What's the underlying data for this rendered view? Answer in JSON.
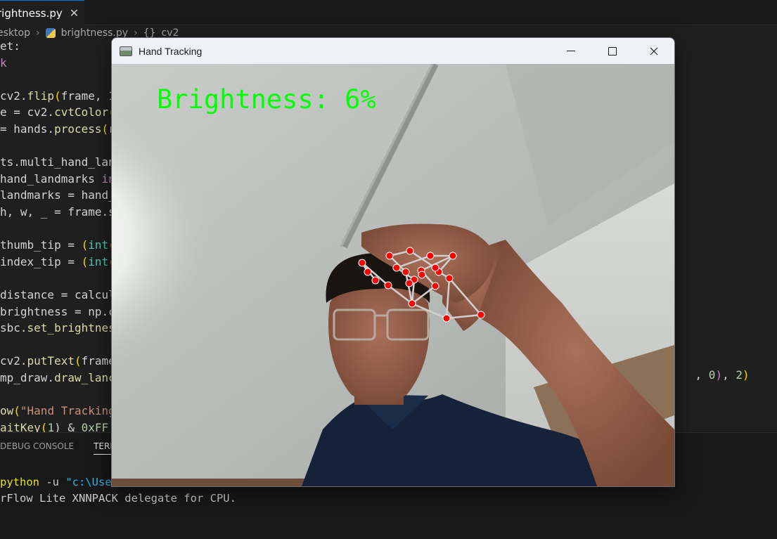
{
  "editor": {
    "tab_label": "rightness.py",
    "tab_close": "✕",
    "breadcrumb": {
      "folder": "esktop",
      "file": "brightness.py",
      "symbol_icon": "{}",
      "symbol": "cv2"
    },
    "code_lines": [
      [
        {
          "t": "et:",
          "c": ""
        }
      ],
      [
        {
          "t": "k",
          "c": "kw"
        }
      ],
      [
        {
          "t": "",
          "c": ""
        }
      ],
      [
        {
          "t": "cv2.",
          "c": ""
        },
        {
          "t": "flip",
          "c": "fn"
        },
        {
          "t": "(",
          "c": "par"
        },
        {
          "t": "frame, 1",
          "c": ""
        }
      ],
      [
        {
          "t": "e = cv2.",
          "c": ""
        },
        {
          "t": "cvtColor",
          "c": "fn"
        },
        {
          "t": "(",
          "c": "par"
        }
      ],
      [
        {
          "t": "= hands.",
          "c": ""
        },
        {
          "t": "process",
          "c": "fn"
        },
        {
          "t": "(",
          "c": "par"
        },
        {
          "t": "r",
          "c": ""
        }
      ],
      [
        {
          "t": "",
          "c": ""
        }
      ],
      [
        {
          "t": "ts.multi_hand_lan",
          "c": ""
        }
      ],
      [
        {
          "t": "hand_landmarks ",
          "c": ""
        },
        {
          "t": "in",
          "c": "kw"
        }
      ],
      [
        {
          "t": "landmarks = hand_",
          "c": ""
        }
      ],
      [
        {
          "t": "h, w, _ = frame.s",
          "c": ""
        }
      ],
      [
        {
          "t": "",
          "c": ""
        }
      ],
      [
        {
          "t": "thumb_tip = ",
          "c": ""
        },
        {
          "t": "(",
          "c": "par"
        },
        {
          "t": "int",
          "c": "typ"
        },
        {
          "t": "(",
          "c": "par"
        }
      ],
      [
        {
          "t": "index_tip = ",
          "c": ""
        },
        {
          "t": "(",
          "c": "par"
        },
        {
          "t": "int",
          "c": "typ"
        },
        {
          "t": "(",
          "c": "par"
        }
      ],
      [
        {
          "t": "",
          "c": ""
        }
      ],
      [
        {
          "t": "distance = calcul",
          "c": ""
        }
      ],
      [
        {
          "t": "brightness = np.c",
          "c": ""
        }
      ],
      [
        {
          "t": "sbc.",
          "c": ""
        },
        {
          "t": "set_brightnes",
          "c": "fn"
        }
      ],
      [
        {
          "t": "",
          "c": ""
        }
      ],
      [
        {
          "t": "cv2.",
          "c": ""
        },
        {
          "t": "putText",
          "c": "fn"
        },
        {
          "t": "(",
          "c": "par"
        },
        {
          "t": "frame",
          "c": ""
        }
      ],
      [
        {
          "t": "mp_draw.",
          "c": ""
        },
        {
          "t": "draw_lanc",
          "c": "fn"
        }
      ],
      [
        {
          "t": "",
          "c": ""
        }
      ],
      [
        {
          "t": "ow",
          "c": "fn"
        },
        {
          "t": "(",
          "c": "par"
        },
        {
          "t": "\"Hand Tracking",
          "c": "str"
        }
      ],
      [
        {
          "t": "aitKey",
          "c": "fn"
        },
        {
          "t": "(",
          "c": "par"
        },
        {
          "t": "1",
          "c": "num"
        },
        {
          "t": ") & ",
          "c": ""
        },
        {
          "t": "0xFF",
          "c": "num"
        }
      ]
    ],
    "code_tail": {
      "t1": ", ",
      "n1": "0",
      "p1": ")",
      "t2": ", ",
      "n2": "2",
      "p2": ")"
    }
  },
  "panel": {
    "tabs": [
      "DEBUG CONSOLE",
      "TERMINAL"
    ],
    "terminal_lines": [
      {
        "parts": [
          {
            "t": "python",
            "c": "yl"
          },
          {
            "t": " -u ",
            "c": ""
          },
          {
            "t": "\"c:\\Users\\...\"",
            "c": "cy"
          }
        ]
      },
      {
        "parts": [
          {
            "t": "rFlow Lite XNNPACK delegate for CPU.",
            "c": ""
          }
        ]
      }
    ]
  },
  "window": {
    "title": "Hand Tracking",
    "overlay_text": "Brightness: 6%",
    "overlay_color": "#00ff00",
    "landmark_color": "#ff0000",
    "connection_color": "#d0d0d0"
  }
}
